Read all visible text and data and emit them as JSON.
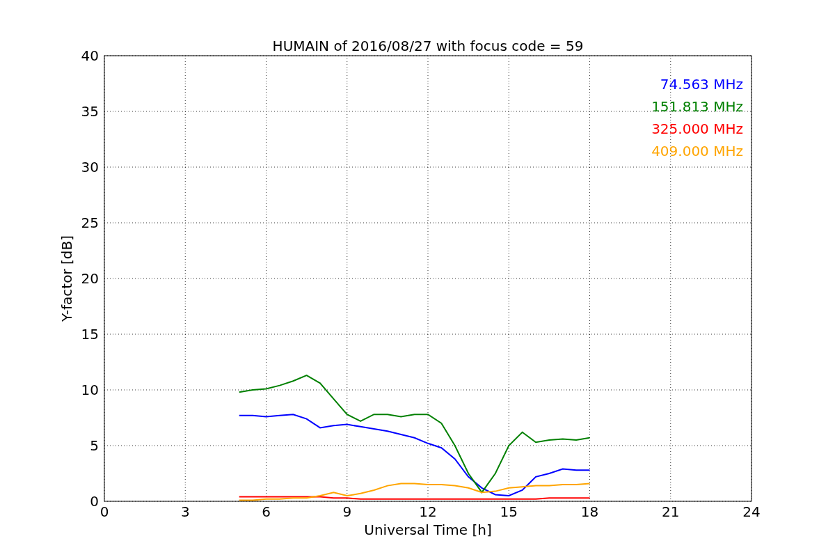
{
  "chart_data": {
    "type": "line",
    "grid": true,
    "title": "HUMAIN of 2016/08/27 with focus code = 59",
    "xlabel": "Universal Time [h]",
    "ylabel": "Y-factor [dB]",
    "x": [
      5,
      5.5,
      6,
      6.5,
      7,
      7.5,
      8,
      8.5,
      9,
      9.5,
      10,
      10.5,
      11,
      11.5,
      12,
      12.5,
      13,
      13.5,
      14,
      14.5,
      15,
      15.5,
      16,
      16.5,
      17,
      17.5,
      18
    ],
    "xlim": [
      0,
      24
    ],
    "ylim": [
      0,
      40
    ],
    "xticks": [
      0,
      3,
      6,
      9,
      12,
      15,
      18,
      21,
      24
    ],
    "yticks": [
      0,
      5,
      10,
      15,
      20,
      25,
      30,
      35,
      40
    ],
    "series": [
      {
        "name": "74.563 MHz",
        "color": "#0000ff",
        "values": [
          7.7,
          7.7,
          7.6,
          7.7,
          7.8,
          7.4,
          6.6,
          6.8,
          6.9,
          6.7,
          6.5,
          6.3,
          6.0,
          5.7,
          5.2,
          4.8,
          3.8,
          2.2,
          1.2,
          0.6,
          0.5,
          1.0,
          2.2,
          2.5,
          2.9,
          2.8,
          2.8
        ]
      },
      {
        "name": "151.813 MHz",
        "color": "#008000",
        "values": [
          9.8,
          10.0,
          10.1,
          10.4,
          10.8,
          11.3,
          10.6,
          9.2,
          7.8,
          7.2,
          7.8,
          7.8,
          7.6,
          7.8,
          7.8,
          7.0,
          5.0,
          2.5,
          0.8,
          2.5,
          5.0,
          6.2,
          5.3,
          5.5,
          5.6,
          5.5,
          5.7
        ]
      },
      {
        "name": "325.000 MHz",
        "color": "#ff0000",
        "values": [
          0.4,
          0.4,
          0.4,
          0.4,
          0.4,
          0.4,
          0.4,
          0.3,
          0.3,
          0.2,
          0.2,
          0.2,
          0.2,
          0.2,
          0.2,
          0.2,
          0.2,
          0.2,
          0.2,
          0.2,
          0.2,
          0.2,
          0.2,
          0.3,
          0.3,
          0.3,
          0.3
        ]
      },
      {
        "name": "409.000 MHz",
        "color": "#ffa500",
        "values": [
          0.1,
          0.1,
          0.2,
          0.2,
          0.3,
          0.3,
          0.5,
          0.8,
          0.5,
          0.7,
          1.0,
          1.4,
          1.6,
          1.6,
          1.5,
          1.5,
          1.4,
          1.2,
          0.8,
          0.9,
          1.2,
          1.3,
          1.4,
          1.4,
          1.5,
          1.5,
          1.6
        ]
      }
    ]
  }
}
